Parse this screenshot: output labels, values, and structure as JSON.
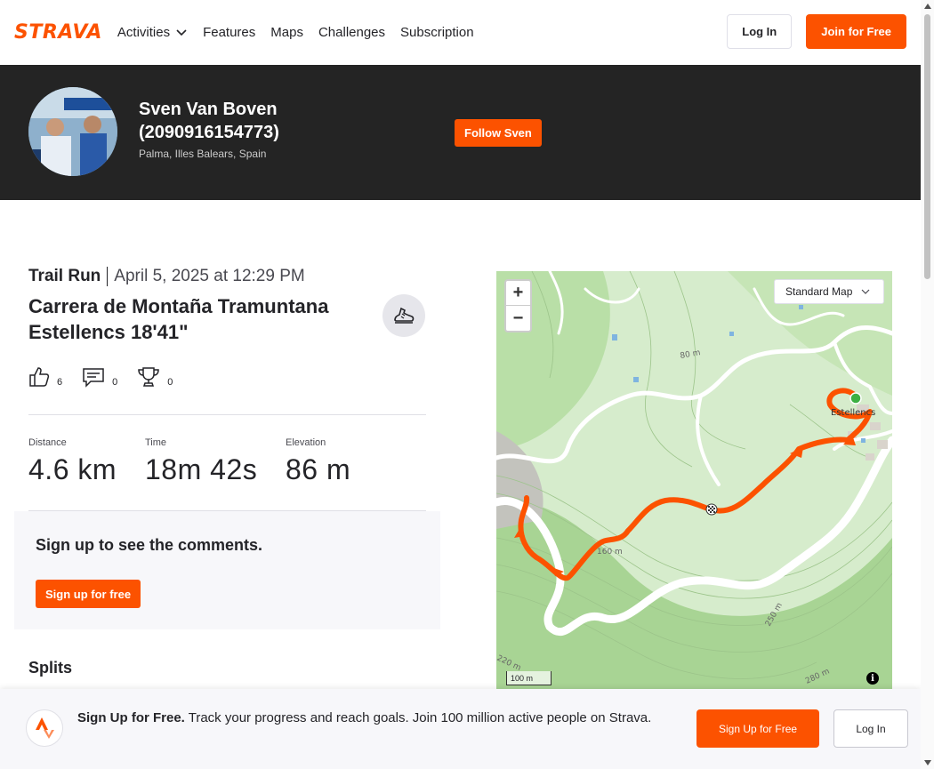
{
  "nav": {
    "logo": "STRAVA",
    "items": [
      {
        "label": "Activities",
        "has_dropdown": true
      },
      {
        "label": "Features"
      },
      {
        "label": "Maps"
      },
      {
        "label": "Challenges"
      },
      {
        "label": "Subscription"
      }
    ],
    "login_label": "Log In",
    "join_label": "Join for Free"
  },
  "athlete": {
    "name": "Sven Van Boven (2090916154773)",
    "location": "Palma, Illes Balears, Spain",
    "follow_label": "Follow Sven"
  },
  "activity": {
    "type": "Trail Run",
    "date": "April 5, 2025 at 12:29 PM",
    "title": "Carrera de Montaña Tramuntana Estellencs 18'41\"",
    "kudos": "6",
    "comments": "0",
    "achievements": "0",
    "stats": [
      {
        "label": "Distance",
        "value": "4.6 km"
      },
      {
        "label": "Time",
        "value": "18m 42s"
      },
      {
        "label": "Elevation",
        "value": "86 m"
      }
    ]
  },
  "comments": {
    "title": "Sign up to see the comments.",
    "button": "Sign up for free"
  },
  "splits": {
    "title": "Splits"
  },
  "map": {
    "style_select": "Standard Map",
    "zoom_in": "+",
    "zoom_out": "−",
    "scale": "100 m",
    "place_label": "Estellencs",
    "contour_labels": [
      "80 m",
      "160 m",
      "250 m",
      "220 m",
      "280 m"
    ],
    "info": "i",
    "colors": {
      "route": "#fc5200",
      "land": "#d6eccc",
      "forest": "#b9dfa7",
      "road": "#ffffff",
      "start": "#3cb043"
    }
  },
  "signup_bar": {
    "bold": "Sign Up for Free.",
    "text": " Track your progress and reach goals. Join 100 million active people on Strava.",
    "signup_label": "Sign Up for Free",
    "login_label": "Log In"
  }
}
